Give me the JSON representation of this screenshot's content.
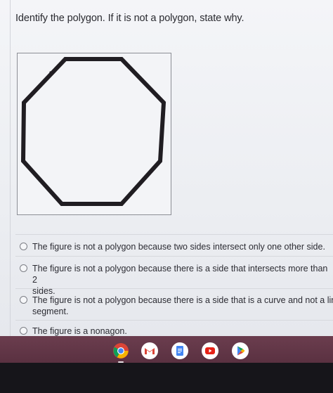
{
  "question": "Identify the polygon. If it is not a polygon, state why.",
  "options": [
    {
      "lines": [
        "The figure is not a polygon because two sides intersect only one other side."
      ]
    },
    {
      "lines": [
        "The figure is not a polygon because there is a side that intersects more than 2",
        "sides."
      ]
    },
    {
      "lines": [
        "The figure is not a polygon because there is a side that is a curve and not a line",
        "segment."
      ]
    },
    {
      "lines": [
        "The figure is a nonagon."
      ]
    }
  ],
  "shelf": {
    "apps": [
      "chrome-icon",
      "gmail-icon",
      "docs-icon",
      "youtube-icon",
      "play-store-icon"
    ],
    "colors": {
      "shelf": "#5f3545",
      "chrome_red": "#db4437",
      "chrome_green": "#0f9d58",
      "chrome_yellow": "#f4b400",
      "chrome_blue": "#4285f4",
      "youtube": "#e62117"
    }
  }
}
